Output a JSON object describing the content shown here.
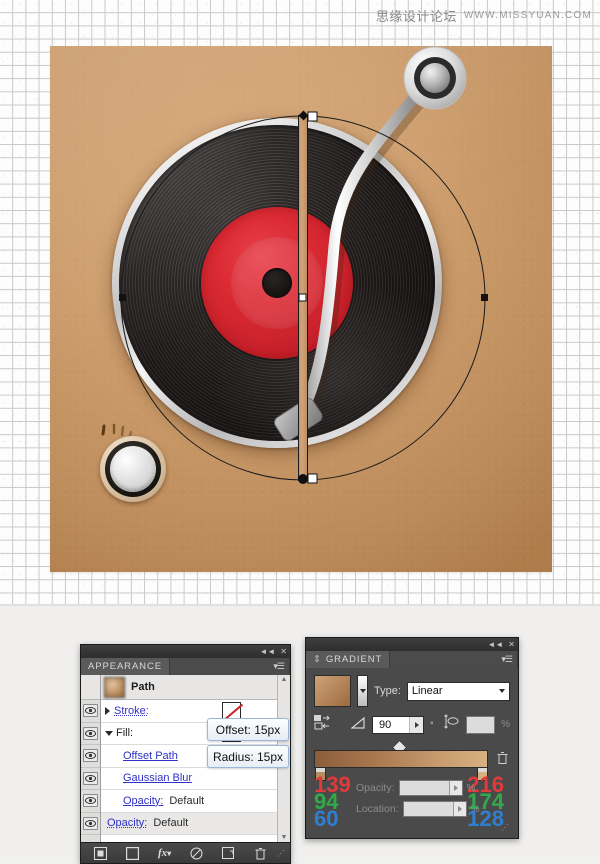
{
  "watermark": {
    "cn": "思缘设计论坛",
    "url": "WWW.MISSYUAN.COM"
  },
  "artwork": {
    "name": "turntable-illustration",
    "background_color": "#cd9d6c",
    "record_color": "#1d1a19",
    "label_color": "#d02a34",
    "tonearm_color": "#c9c9c9",
    "knob_color": "#d5d5d5",
    "selected_path_fill": "#c6996d"
  },
  "appearance_panel": {
    "title": "APPEARANCE",
    "collapse_icon": "double-chevron-left-icon",
    "close_icon": "close-icon",
    "menu_icon": "panel-menu-icon",
    "target_label": "Path",
    "rows": [
      {
        "label": "Stroke:",
        "value": "",
        "swatch": "none",
        "disclosure": "right",
        "visibility": "visible"
      },
      {
        "label": "Fill:",
        "value": "",
        "swatch": "fill",
        "disclosure": "down",
        "visibility": "visible"
      },
      {
        "label": "Offset Path",
        "value": "",
        "swatch": "",
        "disclosure": "",
        "visibility": "visible"
      },
      {
        "label": "Gaussian Blur",
        "value": "",
        "swatch": "",
        "disclosure": "",
        "visibility": "visible"
      },
      {
        "label": "Opacity:",
        "value": "Default",
        "swatch": "",
        "disclosure": "",
        "visibility": "visible"
      },
      {
        "label": "Opacity:",
        "value": "Default",
        "swatch": "",
        "disclosure": "",
        "visibility": "visible"
      }
    ],
    "callouts": [
      {
        "text": "Offset: 15px"
      },
      {
        "text": "Radius: 15px"
      }
    ],
    "footer_icons": [
      "add-new-stroke-icon",
      "add-new-fill-icon",
      "add-new-effect-icon",
      "clear-appearance-icon",
      "duplicate-item-icon",
      "delete-item-icon"
    ],
    "scroll_up_icon": "triangle-up-icon",
    "scroll_down_icon": "triangle-down-icon"
  },
  "gradient_panel": {
    "title": "GRADIENT",
    "collapse_icon": "double-chevron-left-icon",
    "close_icon": "close-icon",
    "menu_icon": "panel-menu-icon",
    "gradient_preview_colors": [
      "#8b5e3c",
      "#d8b080"
    ],
    "type_label": "Type:",
    "type_value": "Linear",
    "type_dropdown_icon": "chevron-down-icon",
    "reverse_icon": "reverse-gradient-icon",
    "angle_icon": "angle-icon",
    "angle_value": "90",
    "angle_unit": "°",
    "aspect_icon": "aspect-ratio-icon",
    "aspect_value": "",
    "aspect_unit": "%",
    "delete_stop_icon": "trash-icon",
    "stops": [
      {
        "position": "left",
        "r": "139",
        "g": "94",
        "b": "60"
      },
      {
        "position": "right",
        "r": "216",
        "g": "174",
        "b": "128"
      }
    ],
    "opacity_label": "Opacity:",
    "opacity_value": "",
    "opacity_unit": "%",
    "location_label": "Location:",
    "location_value": "",
    "location_unit": "%",
    "resize_icon": "resize-grip-icon"
  }
}
